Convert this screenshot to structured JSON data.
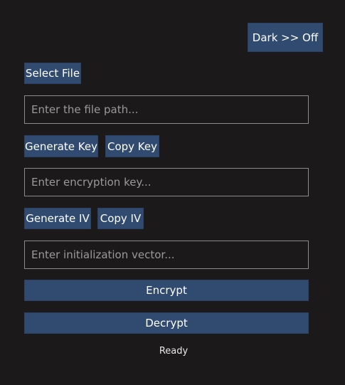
{
  "theme_toggle": {
    "label": "Dark >> Off"
  },
  "file": {
    "select_label": "Select File",
    "path_placeholder": "Enter the file path...",
    "path_value": ""
  },
  "key": {
    "generate_label": "Generate Key",
    "copy_label": "Copy Key",
    "placeholder": "Enter encryption key...",
    "value": ""
  },
  "iv": {
    "generate_label": "Generate IV",
    "copy_label": "Copy IV",
    "placeholder": "Enter initialization vector...",
    "value": ""
  },
  "actions": {
    "encrypt_label": "Encrypt",
    "decrypt_label": "Decrypt"
  },
  "status": {
    "text": "Ready"
  },
  "colors": {
    "background": "#1b191a",
    "button": "#304a70",
    "field_border": "#8b8b8b",
    "text": "#ffffff",
    "placeholder": "#9a9a9a"
  }
}
